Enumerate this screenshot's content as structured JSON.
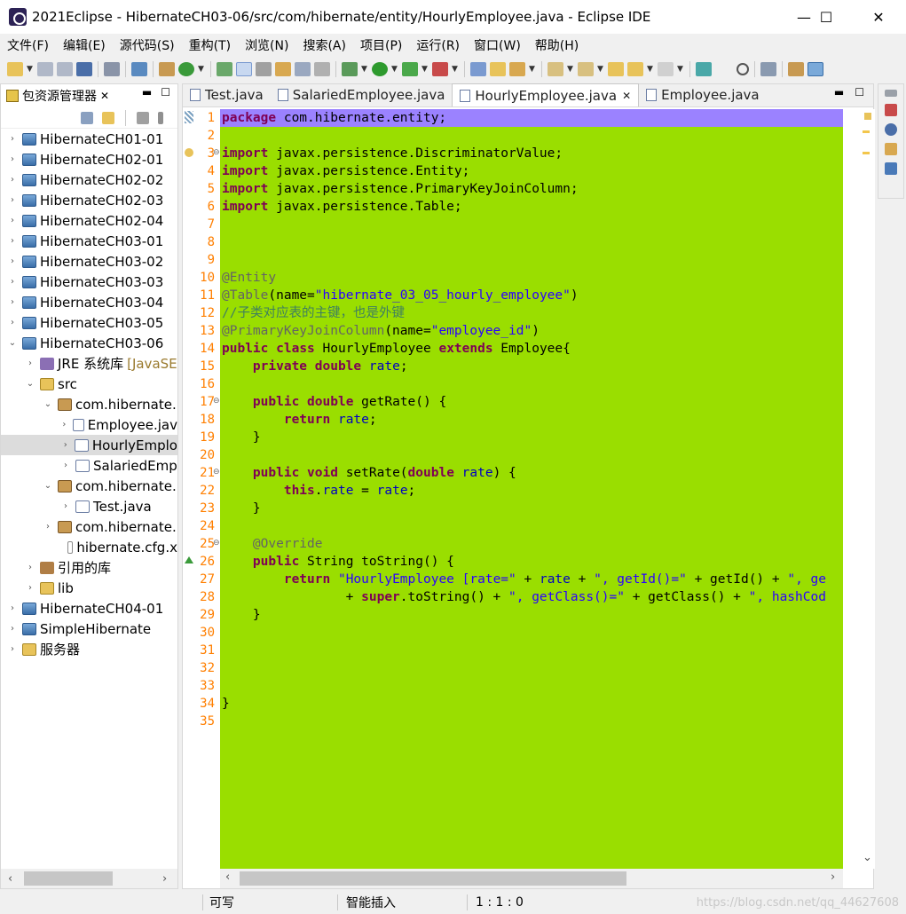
{
  "window": {
    "title": "2021Eclipse - HibernateCH03-06/src/com/hibernate/entity/HourlyEmployee.java - Eclipse IDE",
    "minimize": "—",
    "maximize": "☐",
    "close": "✕"
  },
  "menu": [
    "文件(F)",
    "编辑(E)",
    "源代码(S)",
    "重构(T)",
    "浏览(N)",
    "搜索(A)",
    "项目(P)",
    "运行(R)",
    "窗口(W)",
    "帮助(H)"
  ],
  "left_panel": {
    "title": "包资源管理器",
    "items": [
      {
        "label": "HibernateCH01-01",
        "arrow": "›",
        "icon": "project-icon"
      },
      {
        "label": "HibernateCH02-01",
        "arrow": "›",
        "icon": "project-icon"
      },
      {
        "label": "HibernateCH02-02",
        "arrow": "›",
        "icon": "project-icon"
      },
      {
        "label": "HibernateCH02-03",
        "arrow": "›",
        "icon": "project-icon"
      },
      {
        "label": "HibernateCH02-04",
        "arrow": "›",
        "icon": "project-icon"
      },
      {
        "label": "HibernateCH03-01",
        "arrow": "›",
        "icon": "project-icon"
      },
      {
        "label": "HibernateCH03-02",
        "arrow": "›",
        "icon": "project-icon"
      },
      {
        "label": "HibernateCH03-03",
        "arrow": "›",
        "icon": "project-icon"
      },
      {
        "label": "HibernateCH03-04",
        "arrow": "›",
        "icon": "project-icon"
      },
      {
        "label": "HibernateCH03-05",
        "arrow": "›",
        "icon": "project-icon"
      },
      {
        "label": "HibernateCH03-06",
        "arrow": "⌄",
        "icon": "project-icon"
      },
      {
        "label": "JRE 系统库",
        "suffix": "[JavaSE",
        "arrow": "›",
        "icon": "jre-library-icon"
      },
      {
        "label": "src",
        "arrow": "⌄",
        "icon": "source-folder-icon"
      },
      {
        "label": "com.hibernate.",
        "arrow": "⌄",
        "icon": "package-icon"
      },
      {
        "label": "Employee.jav",
        "arrow": "›",
        "icon": "java-file-icon"
      },
      {
        "label": "HourlyEmplo",
        "arrow": "›",
        "icon": "java-file-icon"
      },
      {
        "label": "SalariedEmp",
        "arrow": "›",
        "icon": "java-file-icon"
      },
      {
        "label": "com.hibernate.",
        "arrow": "⌄",
        "icon": "package-icon"
      },
      {
        "label": "Test.java",
        "arrow": "›",
        "icon": "java-file-icon"
      },
      {
        "label": "com.hibernate.",
        "arrow": "›",
        "icon": "package-icon"
      },
      {
        "label": "hibernate.cfg.x",
        "arrow": "",
        "icon": "xml-file-icon"
      },
      {
        "label": "引用的库",
        "arrow": "›",
        "icon": "library-icon"
      },
      {
        "label": "lib",
        "arrow": "›",
        "icon": "folder-icon"
      },
      {
        "label": "HibernateCH04-01",
        "arrow": "›",
        "icon": "project-icon"
      },
      {
        "label": "SimpleHibernate",
        "arrow": "›",
        "icon": "project-icon"
      },
      {
        "label": "服务器",
        "arrow": "›",
        "icon": "server-folder-icon"
      }
    ]
  },
  "editor": {
    "tabs": [
      {
        "label": "Test.java",
        "active": false
      },
      {
        "label": "SalariedEmployee.java",
        "active": false
      },
      {
        "label": "HourlyEmployee.java",
        "active": true
      },
      {
        "label": "Employee.java",
        "active": false
      }
    ],
    "line_numbers": [
      "1",
      "2",
      "3",
      "4",
      "5",
      "6",
      "7",
      "8",
      "9",
      "10",
      "11",
      "12",
      "13",
      "14",
      "15",
      "16",
      "17",
      "18",
      "19",
      "20",
      "21",
      "22",
      "23",
      "24",
      "25",
      "26",
      "27",
      "28",
      "29",
      "30",
      "31",
      "32",
      "33",
      "34",
      "35"
    ],
    "code": [
      "package com.hibernate.entity;",
      "",
      "import javax.persistence.DiscriminatorValue;",
      "import javax.persistence.Entity;",
      "import javax.persistence.PrimaryKeyJoinColumn;",
      "import javax.persistence.Table;",
      "",
      "",
      "",
      "@Entity",
      "@Table(name=\"hibernate_03_05_hourly_employee\")",
      "//子类对应表的主键，也是外键",
      "@PrimaryKeyJoinColumn(name=\"employee_id\")",
      "public class HourlyEmployee extends Employee{",
      "    private double rate;",
      "",
      "    public double getRate() {",
      "        return rate;",
      "    }",
      "",
      "    public void setRate(double rate) {",
      "        this.rate = rate;",
      "    }",
      "",
      "    @Override",
      "    public String toString() {",
      "        return \"HourlyEmployee [rate=\" + rate + \", getId()=\" + getId() + \", ge",
      "                + super.toString() + \", getClass()=\" + getClass() + \", hashCod",
      "    }",
      "",
      "",
      "",
      "",
      "}",
      ""
    ]
  },
  "status": {
    "writable": "可写",
    "insert_mode": "智能插入",
    "position": "1 : 1 : 0"
  },
  "watermark": "https://blog.csdn.net/qq_44627608",
  "colors": {
    "code_background": "#9ade00",
    "current_line": "#9b82ff",
    "line_number": "#ff7f00"
  }
}
